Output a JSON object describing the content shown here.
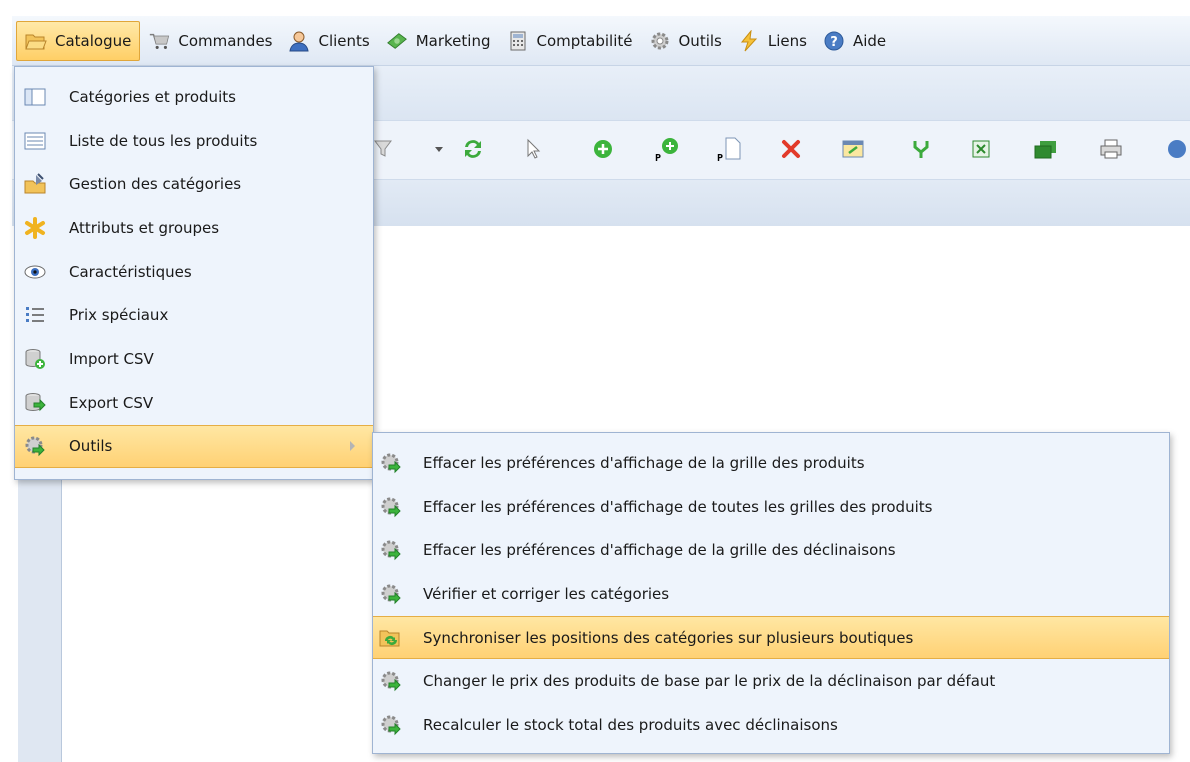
{
  "menubar": {
    "items": [
      {
        "label": "Catalogue",
        "icon": "folder-open-icon",
        "active": true
      },
      {
        "label": "Commandes",
        "icon": "shopping-cart-icon"
      },
      {
        "label": "Clients",
        "icon": "user-icon"
      },
      {
        "label": "Marketing",
        "icon": "money-icon"
      },
      {
        "label": "Comptabilité",
        "icon": "calculator-icon"
      },
      {
        "label": "Outils",
        "icon": "gear-icon"
      },
      {
        "label": "Liens",
        "icon": "lightning-icon"
      },
      {
        "label": "Aide",
        "icon": "help-icon"
      }
    ]
  },
  "catalogue_menu": {
    "items": [
      {
        "label": "Catégories et produits",
        "icon": "tree-panel-icon"
      },
      {
        "label": "Liste de tous les produits",
        "icon": "list-icon"
      },
      {
        "label": "Gestion des catégories",
        "icon": "edit-folder-icon"
      },
      {
        "label": "Attributs et groupes",
        "icon": "asterisk-icon"
      },
      {
        "label": "Caractéristiques",
        "icon": "eye-icon"
      },
      {
        "label": "Prix spéciaux",
        "icon": "numbered-list-icon"
      },
      {
        "label": "Import CSV",
        "icon": "database-add-icon"
      },
      {
        "label": "Export CSV",
        "icon": "database-export-icon"
      },
      {
        "label": "Outils",
        "icon": "gear-arrow-icon",
        "active": true,
        "has_submenu": true
      }
    ]
  },
  "outils_submenu": {
    "items": [
      {
        "label": "Effacer les préférences d'affichage de la grille des produits",
        "icon": "gear-arrow-icon"
      },
      {
        "label": "Effacer les préférences d'affichage de toutes les grilles des produits",
        "icon": "gear-arrow-icon"
      },
      {
        "label": "Effacer les préférences d'affichage de la grille des déclinaisons",
        "icon": "gear-arrow-icon"
      },
      {
        "label": "Vérifier et corriger les catégories",
        "icon": "gear-arrow-icon"
      },
      {
        "label": "Synchroniser les positions des catégories sur plusieurs boutiques",
        "icon": "folder-sync-icon",
        "active": true
      },
      {
        "label": "Changer le prix des produits de base par le prix de la déclinaison par défaut",
        "icon": "gear-arrow-icon"
      },
      {
        "label": "Recalculer le stock total des produits avec déclinaisons",
        "icon": "gear-arrow-icon"
      }
    ]
  },
  "colors": {
    "highlight": "#ffd174",
    "menu_bg": "#eef4fc",
    "border": "#9fb4d2"
  }
}
